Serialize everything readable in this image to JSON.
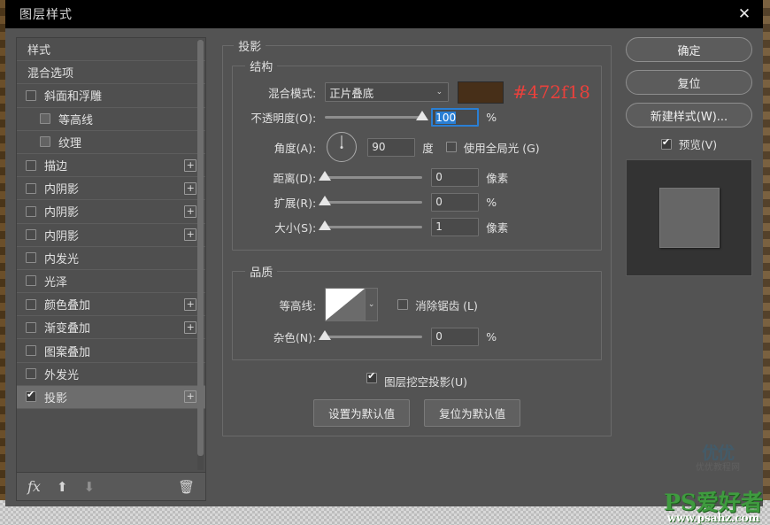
{
  "window": {
    "title": "图层样式",
    "close_icon": "close-icon"
  },
  "style_list": {
    "items": [
      {
        "label": "样式",
        "type": "plain",
        "checkbox": "none",
        "plus": false,
        "selected": false
      },
      {
        "label": "混合选项",
        "type": "plain",
        "checkbox": "none",
        "plus": false,
        "selected": false
      },
      {
        "label": "斜面和浮雕",
        "type": "normal",
        "checkbox": "unchecked",
        "plus": false,
        "selected": false
      },
      {
        "label": "等高线",
        "type": "indent",
        "checkbox": "unchecked",
        "plus": false,
        "selected": false
      },
      {
        "label": "纹理",
        "type": "indent",
        "checkbox": "unchecked",
        "plus": false,
        "selected": false
      },
      {
        "label": "描边",
        "type": "normal",
        "checkbox": "unchecked",
        "plus": true,
        "selected": false
      },
      {
        "label": "内阴影",
        "type": "normal",
        "checkbox": "unchecked",
        "plus": true,
        "selected": false
      },
      {
        "label": "内阴影",
        "type": "normal",
        "checkbox": "unchecked",
        "plus": true,
        "selected": false
      },
      {
        "label": "内阴影",
        "type": "normal",
        "checkbox": "unchecked",
        "plus": true,
        "selected": false
      },
      {
        "label": "内发光",
        "type": "normal",
        "checkbox": "unchecked",
        "plus": false,
        "selected": false
      },
      {
        "label": "光泽",
        "type": "normal",
        "checkbox": "unchecked",
        "plus": false,
        "selected": false
      },
      {
        "label": "颜色叠加",
        "type": "normal",
        "checkbox": "unchecked",
        "plus": true,
        "selected": false
      },
      {
        "label": "渐变叠加",
        "type": "normal",
        "checkbox": "unchecked",
        "plus": true,
        "selected": false
      },
      {
        "label": "图案叠加",
        "type": "normal",
        "checkbox": "unchecked",
        "plus": false,
        "selected": false
      },
      {
        "label": "外发光",
        "type": "normal",
        "checkbox": "unchecked",
        "plus": false,
        "selected": false
      },
      {
        "label": "投影",
        "type": "normal",
        "checkbox": "checked",
        "plus": true,
        "selected": true
      }
    ]
  },
  "left_toolbar": {
    "fx_icon": "fx-icon",
    "fx_label": "fx",
    "move_up_icon": "arrow-up-icon",
    "move_up_glyph": "⬆",
    "move_down_icon": "arrow-down-icon",
    "move_down_glyph": "⬇",
    "delete_icon": "trash-icon",
    "delete_glyph": "🗑"
  },
  "panel": {
    "section_title": "投影",
    "structure": {
      "legend": "结构",
      "blend_mode_label": "混合模式:",
      "blend_mode_value": "正片叠底",
      "blend_mode_caret": "⌄",
      "color_swatch_hex": "#472f18",
      "color_annotation": "#472f18",
      "opacity_label": "不透明度(O):",
      "opacity_value": "100",
      "opacity_unit": "%",
      "opacity_percent": 100,
      "angle_label": "角度(A):",
      "angle_value": "90",
      "angle_unit": "度",
      "global_light_label": "使用全局光 (G)",
      "global_light_checked": false,
      "distance_label": "距离(D):",
      "distance_value": "0",
      "distance_unit": "像素",
      "distance_percent": 0,
      "spread_label": "扩展(R):",
      "spread_value": "0",
      "spread_unit": "%",
      "spread_percent": 0,
      "size_label": "大小(S):",
      "size_value": "1",
      "size_unit": "像素",
      "size_percent": 0
    },
    "quality": {
      "legend": "品质",
      "contour_label": "等高线:",
      "contour_caret": "⌄",
      "antialias_label": "消除锯齿 (L)",
      "antialias_checked": false,
      "noise_label": "杂色(N):",
      "noise_value": "0",
      "noise_unit": "%",
      "noise_percent": 0
    },
    "knockout": {
      "label": "图层挖空投影(U)",
      "checked": true
    },
    "buttons": {
      "set_default": "设置为默认值",
      "reset_default": "复位为默认值"
    }
  },
  "right_panel": {
    "ok": "确定",
    "reset": "复位",
    "new_style": "新建样式(W)...",
    "preview_label": "预览(V)",
    "preview_checked": true
  },
  "watermarks": {
    "uu_top": "优优",
    "uu_bottom": "优优教程网",
    "ps_main": "PS爱好者",
    "ps_url": "www.psahz.com"
  }
}
